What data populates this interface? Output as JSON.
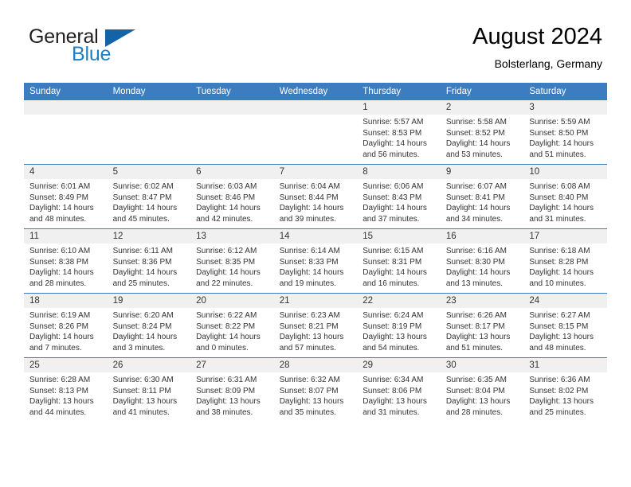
{
  "brand": {
    "name_part1": "General",
    "name_part2": "Blue",
    "triangle_color": "#1263a8",
    "blue_text_color": "#1f7fc4"
  },
  "header": {
    "title": "August 2024",
    "location": "Bolsterlang, Germany"
  },
  "theme": {
    "header_blue": "#3b7dc0",
    "daynum_band": "#f0f0f0",
    "text": "#333333"
  },
  "weekday_headers": [
    "Sunday",
    "Monday",
    "Tuesday",
    "Wednesday",
    "Thursday",
    "Friday",
    "Saturday"
  ],
  "weeks": [
    [
      {
        "day": "",
        "sunrise": "",
        "sunset": "",
        "daylight1": "",
        "daylight2": "",
        "blank": true
      },
      {
        "day": "",
        "sunrise": "",
        "sunset": "",
        "daylight1": "",
        "daylight2": "",
        "blank": true
      },
      {
        "day": "",
        "sunrise": "",
        "sunset": "",
        "daylight1": "",
        "daylight2": "",
        "blank": true
      },
      {
        "day": "",
        "sunrise": "",
        "sunset": "",
        "daylight1": "",
        "daylight2": "",
        "blank": true
      },
      {
        "day": "1",
        "sunrise": "Sunrise: 5:57 AM",
        "sunset": "Sunset: 8:53 PM",
        "daylight1": "Daylight: 14 hours",
        "daylight2": "and 56 minutes.",
        "blank": false
      },
      {
        "day": "2",
        "sunrise": "Sunrise: 5:58 AM",
        "sunset": "Sunset: 8:52 PM",
        "daylight1": "Daylight: 14 hours",
        "daylight2": "and 53 minutes.",
        "blank": false
      },
      {
        "day": "3",
        "sunrise": "Sunrise: 5:59 AM",
        "sunset": "Sunset: 8:50 PM",
        "daylight1": "Daylight: 14 hours",
        "daylight2": "and 51 minutes.",
        "blank": false
      }
    ],
    [
      {
        "day": "4",
        "sunrise": "Sunrise: 6:01 AM",
        "sunset": "Sunset: 8:49 PM",
        "daylight1": "Daylight: 14 hours",
        "daylight2": "and 48 minutes.",
        "blank": false
      },
      {
        "day": "5",
        "sunrise": "Sunrise: 6:02 AM",
        "sunset": "Sunset: 8:47 PM",
        "daylight1": "Daylight: 14 hours",
        "daylight2": "and 45 minutes.",
        "blank": false
      },
      {
        "day": "6",
        "sunrise": "Sunrise: 6:03 AM",
        "sunset": "Sunset: 8:46 PM",
        "daylight1": "Daylight: 14 hours",
        "daylight2": "and 42 minutes.",
        "blank": false
      },
      {
        "day": "7",
        "sunrise": "Sunrise: 6:04 AM",
        "sunset": "Sunset: 8:44 PM",
        "daylight1": "Daylight: 14 hours",
        "daylight2": "and 39 minutes.",
        "blank": false
      },
      {
        "day": "8",
        "sunrise": "Sunrise: 6:06 AM",
        "sunset": "Sunset: 8:43 PM",
        "daylight1": "Daylight: 14 hours",
        "daylight2": "and 37 minutes.",
        "blank": false
      },
      {
        "day": "9",
        "sunrise": "Sunrise: 6:07 AM",
        "sunset": "Sunset: 8:41 PM",
        "daylight1": "Daylight: 14 hours",
        "daylight2": "and 34 minutes.",
        "blank": false
      },
      {
        "day": "10",
        "sunrise": "Sunrise: 6:08 AM",
        "sunset": "Sunset: 8:40 PM",
        "daylight1": "Daylight: 14 hours",
        "daylight2": "and 31 minutes.",
        "blank": false
      }
    ],
    [
      {
        "day": "11",
        "sunrise": "Sunrise: 6:10 AM",
        "sunset": "Sunset: 8:38 PM",
        "daylight1": "Daylight: 14 hours",
        "daylight2": "and 28 minutes.",
        "blank": false
      },
      {
        "day": "12",
        "sunrise": "Sunrise: 6:11 AM",
        "sunset": "Sunset: 8:36 PM",
        "daylight1": "Daylight: 14 hours",
        "daylight2": "and 25 minutes.",
        "blank": false
      },
      {
        "day": "13",
        "sunrise": "Sunrise: 6:12 AM",
        "sunset": "Sunset: 8:35 PM",
        "daylight1": "Daylight: 14 hours",
        "daylight2": "and 22 minutes.",
        "blank": false
      },
      {
        "day": "14",
        "sunrise": "Sunrise: 6:14 AM",
        "sunset": "Sunset: 8:33 PM",
        "daylight1": "Daylight: 14 hours",
        "daylight2": "and 19 minutes.",
        "blank": false
      },
      {
        "day": "15",
        "sunrise": "Sunrise: 6:15 AM",
        "sunset": "Sunset: 8:31 PM",
        "daylight1": "Daylight: 14 hours",
        "daylight2": "and 16 minutes.",
        "blank": false
      },
      {
        "day": "16",
        "sunrise": "Sunrise: 6:16 AM",
        "sunset": "Sunset: 8:30 PM",
        "daylight1": "Daylight: 14 hours",
        "daylight2": "and 13 minutes.",
        "blank": false
      },
      {
        "day": "17",
        "sunrise": "Sunrise: 6:18 AM",
        "sunset": "Sunset: 8:28 PM",
        "daylight1": "Daylight: 14 hours",
        "daylight2": "and 10 minutes.",
        "blank": false
      }
    ],
    [
      {
        "day": "18",
        "sunrise": "Sunrise: 6:19 AM",
        "sunset": "Sunset: 8:26 PM",
        "daylight1": "Daylight: 14 hours",
        "daylight2": "and 7 minutes.",
        "blank": false
      },
      {
        "day": "19",
        "sunrise": "Sunrise: 6:20 AM",
        "sunset": "Sunset: 8:24 PM",
        "daylight1": "Daylight: 14 hours",
        "daylight2": "and 3 minutes.",
        "blank": false
      },
      {
        "day": "20",
        "sunrise": "Sunrise: 6:22 AM",
        "sunset": "Sunset: 8:22 PM",
        "daylight1": "Daylight: 14 hours",
        "daylight2": "and 0 minutes.",
        "blank": false
      },
      {
        "day": "21",
        "sunrise": "Sunrise: 6:23 AM",
        "sunset": "Sunset: 8:21 PM",
        "daylight1": "Daylight: 13 hours",
        "daylight2": "and 57 minutes.",
        "blank": false
      },
      {
        "day": "22",
        "sunrise": "Sunrise: 6:24 AM",
        "sunset": "Sunset: 8:19 PM",
        "daylight1": "Daylight: 13 hours",
        "daylight2": "and 54 minutes.",
        "blank": false
      },
      {
        "day": "23",
        "sunrise": "Sunrise: 6:26 AM",
        "sunset": "Sunset: 8:17 PM",
        "daylight1": "Daylight: 13 hours",
        "daylight2": "and 51 minutes.",
        "blank": false
      },
      {
        "day": "24",
        "sunrise": "Sunrise: 6:27 AM",
        "sunset": "Sunset: 8:15 PM",
        "daylight1": "Daylight: 13 hours",
        "daylight2": "and 48 minutes.",
        "blank": false
      }
    ],
    [
      {
        "day": "25",
        "sunrise": "Sunrise: 6:28 AM",
        "sunset": "Sunset: 8:13 PM",
        "daylight1": "Daylight: 13 hours",
        "daylight2": "and 44 minutes.",
        "blank": false
      },
      {
        "day": "26",
        "sunrise": "Sunrise: 6:30 AM",
        "sunset": "Sunset: 8:11 PM",
        "daylight1": "Daylight: 13 hours",
        "daylight2": "and 41 minutes.",
        "blank": false
      },
      {
        "day": "27",
        "sunrise": "Sunrise: 6:31 AM",
        "sunset": "Sunset: 8:09 PM",
        "daylight1": "Daylight: 13 hours",
        "daylight2": "and 38 minutes.",
        "blank": false
      },
      {
        "day": "28",
        "sunrise": "Sunrise: 6:32 AM",
        "sunset": "Sunset: 8:07 PM",
        "daylight1": "Daylight: 13 hours",
        "daylight2": "and 35 minutes.",
        "blank": false
      },
      {
        "day": "29",
        "sunrise": "Sunrise: 6:34 AM",
        "sunset": "Sunset: 8:06 PM",
        "daylight1": "Daylight: 13 hours",
        "daylight2": "and 31 minutes.",
        "blank": false
      },
      {
        "day": "30",
        "sunrise": "Sunrise: 6:35 AM",
        "sunset": "Sunset: 8:04 PM",
        "daylight1": "Daylight: 13 hours",
        "daylight2": "and 28 minutes.",
        "blank": false
      },
      {
        "day": "31",
        "sunrise": "Sunrise: 6:36 AM",
        "sunset": "Sunset: 8:02 PM",
        "daylight1": "Daylight: 13 hours",
        "daylight2": "and 25 minutes.",
        "blank": false
      }
    ]
  ]
}
